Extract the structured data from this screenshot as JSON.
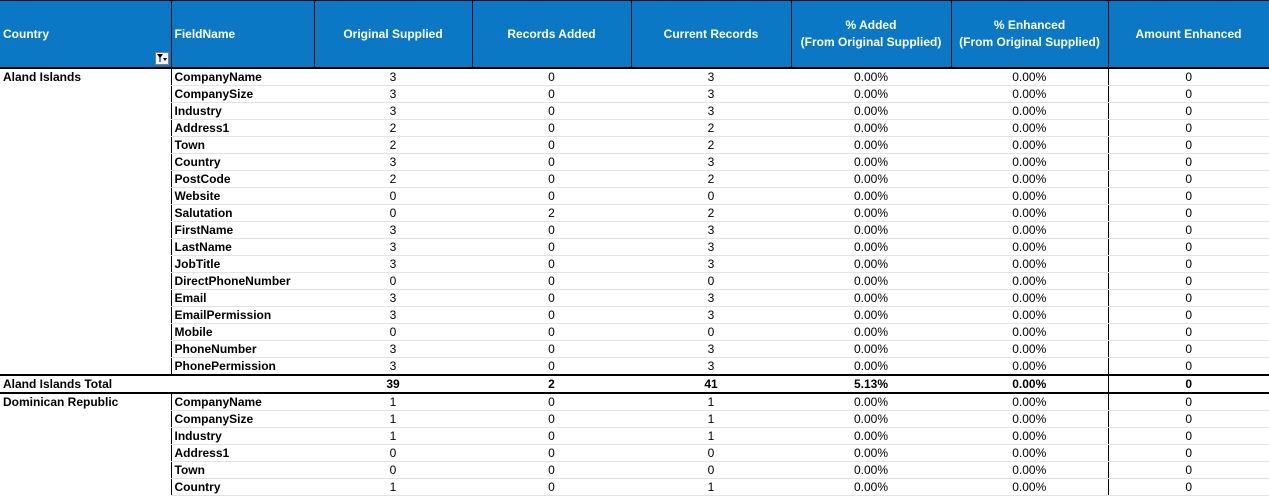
{
  "header": {
    "country": "Country",
    "field_name": "FieldName",
    "original_supplied": "Original Supplied",
    "records_added": "Records Added",
    "current_records": "Current Records",
    "pct_added_line1": "% Added",
    "pct_added_line2": "(From Original Supplied)",
    "pct_enhanced_line1": "% Enhanced",
    "pct_enhanced_line2": "(From Original Supplied)",
    "amount_enhanced": "Amount Enhanced"
  },
  "groups": [
    {
      "country": "Aland Islands",
      "rows": [
        {
          "field": "CompanyName",
          "orig": "3",
          "added": "0",
          "current": "3",
          "pct_added": "0.00%",
          "pct_enh": "0.00%",
          "amount": "0"
        },
        {
          "field": "CompanySize",
          "orig": "3",
          "added": "0",
          "current": "3",
          "pct_added": "0.00%",
          "pct_enh": "0.00%",
          "amount": "0"
        },
        {
          "field": "Industry",
          "orig": "3",
          "added": "0",
          "current": "3",
          "pct_added": "0.00%",
          "pct_enh": "0.00%",
          "amount": "0"
        },
        {
          "field": "Address1",
          "orig": "2",
          "added": "0",
          "current": "2",
          "pct_added": "0.00%",
          "pct_enh": "0.00%",
          "amount": "0"
        },
        {
          "field": "Town",
          "orig": "2",
          "added": "0",
          "current": "2",
          "pct_added": "0.00%",
          "pct_enh": "0.00%",
          "amount": "0"
        },
        {
          "field": "Country",
          "orig": "3",
          "added": "0",
          "current": "3",
          "pct_added": "0.00%",
          "pct_enh": "0.00%",
          "amount": "0"
        },
        {
          "field": "PostCode",
          "orig": "2",
          "added": "0",
          "current": "2",
          "pct_added": "0.00%",
          "pct_enh": "0.00%",
          "amount": "0"
        },
        {
          "field": "Website",
          "orig": "0",
          "added": "0",
          "current": "0",
          "pct_added": "0.00%",
          "pct_enh": "0.00%",
          "amount": "0"
        },
        {
          "field": "Salutation",
          "orig": "0",
          "added": "2",
          "current": "2",
          "pct_added": "0.00%",
          "pct_enh": "0.00%",
          "amount": "0"
        },
        {
          "field": "FirstName",
          "orig": "3",
          "added": "0",
          "current": "3",
          "pct_added": "0.00%",
          "pct_enh": "0.00%",
          "amount": "0"
        },
        {
          "field": "LastName",
          "orig": "3",
          "added": "0",
          "current": "3",
          "pct_added": "0.00%",
          "pct_enh": "0.00%",
          "amount": "0"
        },
        {
          "field": "JobTitle",
          "orig": "3",
          "added": "0",
          "current": "3",
          "pct_added": "0.00%",
          "pct_enh": "0.00%",
          "amount": "0"
        },
        {
          "field": "DirectPhoneNumber",
          "orig": "0",
          "added": "0",
          "current": "0",
          "pct_added": "0.00%",
          "pct_enh": "0.00%",
          "amount": "0"
        },
        {
          "field": "Email",
          "orig": "3",
          "added": "0",
          "current": "3",
          "pct_added": "0.00%",
          "pct_enh": "0.00%",
          "amount": "0"
        },
        {
          "field": "EmailPermission",
          "orig": "3",
          "added": "0",
          "current": "3",
          "pct_added": "0.00%",
          "pct_enh": "0.00%",
          "amount": "0"
        },
        {
          "field": "Mobile",
          "orig": "0",
          "added": "0",
          "current": "0",
          "pct_added": "0.00%",
          "pct_enh": "0.00%",
          "amount": "0"
        },
        {
          "field": "PhoneNumber",
          "orig": "3",
          "added": "0",
          "current": "3",
          "pct_added": "0.00%",
          "pct_enh": "0.00%",
          "amount": "0"
        },
        {
          "field": "PhonePermission",
          "orig": "3",
          "added": "0",
          "current": "3",
          "pct_added": "0.00%",
          "pct_enh": "0.00%",
          "amount": "0"
        }
      ],
      "total": {
        "label": "Aland Islands Total",
        "orig": "39",
        "added": "2",
        "current": "41",
        "pct_added": "5.13%",
        "pct_enh": "0.00%",
        "amount": "0"
      }
    },
    {
      "country": "Dominican Republic",
      "rows": [
        {
          "field": "CompanyName",
          "orig": "1",
          "added": "0",
          "current": "1",
          "pct_added": "0.00%",
          "pct_enh": "0.00%",
          "amount": "0"
        },
        {
          "field": "CompanySize",
          "orig": "1",
          "added": "0",
          "current": "1",
          "pct_added": "0.00%",
          "pct_enh": "0.00%",
          "amount": "0"
        },
        {
          "field": "Industry",
          "orig": "1",
          "added": "0",
          "current": "1",
          "pct_added": "0.00%",
          "pct_enh": "0.00%",
          "amount": "0"
        },
        {
          "field": "Address1",
          "orig": "0",
          "added": "0",
          "current": "0",
          "pct_added": "0.00%",
          "pct_enh": "0.00%",
          "amount": "0"
        },
        {
          "field": "Town",
          "orig": "0",
          "added": "0",
          "current": "0",
          "pct_added": "0.00%",
          "pct_enh": "0.00%",
          "amount": "0"
        },
        {
          "field": "Country",
          "orig": "1",
          "added": "0",
          "current": "1",
          "pct_added": "0.00%",
          "pct_enh": "0.00%",
          "amount": "0"
        }
      ]
    }
  ]
}
